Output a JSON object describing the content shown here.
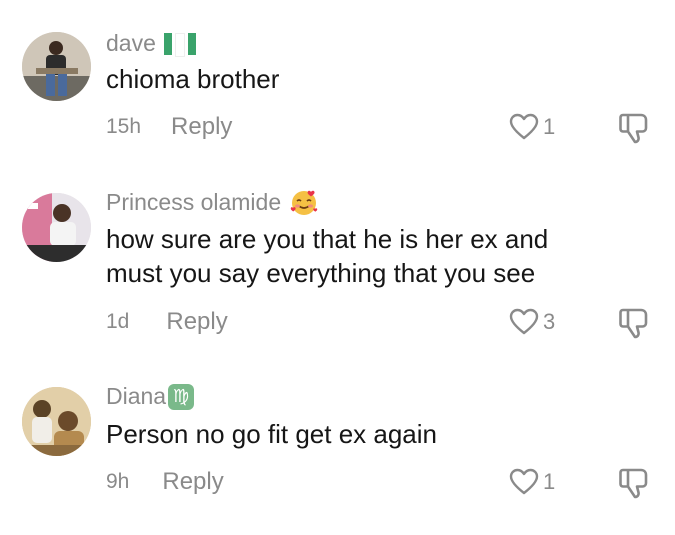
{
  "comments": [
    {
      "username": "dave",
      "username_icon": "nigeria-flag-icon",
      "text": "chioma brother",
      "time": "15h",
      "reply_label": "Reply",
      "likes": "1"
    },
    {
      "username": "Princess olamide",
      "username_icon": "smiling-face-with-hearts-emoji",
      "text": "how sure are you that he is her ex and\nmust you say everything that you see",
      "time": "1d",
      "reply_label": "Reply",
      "likes": "3"
    },
    {
      "username": "Diana",
      "username_icon": "virgo-zodiac-icon",
      "text": "Person no go fit get ex again",
      "time": "9h",
      "reply_label": "Reply",
      "likes": "1"
    }
  ],
  "colors": {
    "muted": "#8a8a8a",
    "text": "#161616",
    "flag_green": "#3aa36b",
    "virgo": "#7ab98a"
  }
}
